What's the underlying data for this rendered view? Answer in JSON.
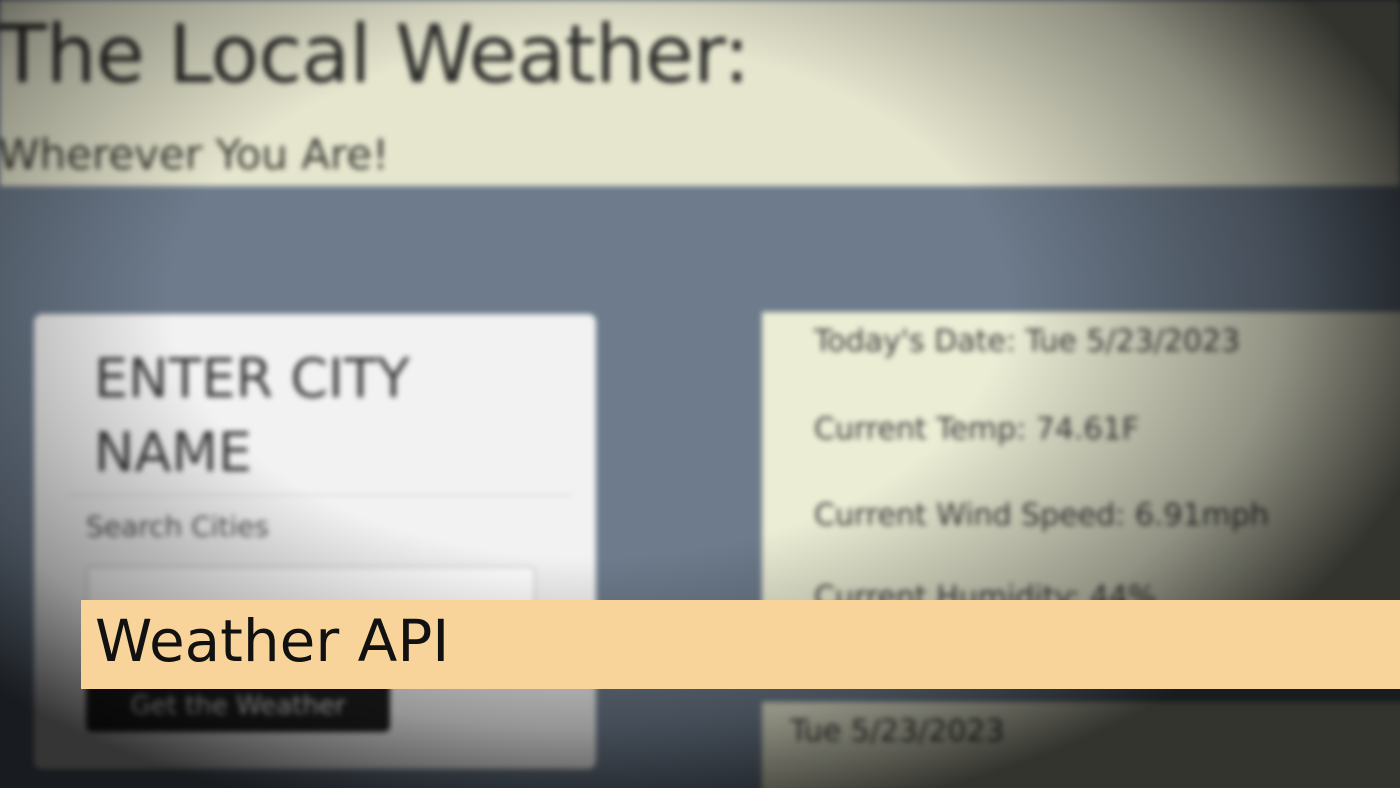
{
  "header": {
    "title": "The Local Weather:",
    "subtitle": "Wherever You Are!"
  },
  "search": {
    "heading": "ENTER CITY NAME",
    "label": "Search Cities",
    "input_value": "",
    "button_label": "Get the Weather"
  },
  "current": {
    "date": "Today's Date: Tue 5/23/2023",
    "temp": "Current Temp: 74.61F",
    "wind": "Current Wind Speed: 6.91mph",
    "humidity": "Current Humidity: 44%"
  },
  "forecast": {
    "date": "Tue 5/23/2023"
  },
  "caption": {
    "text": "Weather API"
  },
  "colors": {
    "header_bg": "#e6e6cf",
    "page_bg": "#6d7b8c",
    "card_bg": "#f2f2f2",
    "info_bg": "#ecedd5",
    "banner_bg": "#f8d49a"
  }
}
